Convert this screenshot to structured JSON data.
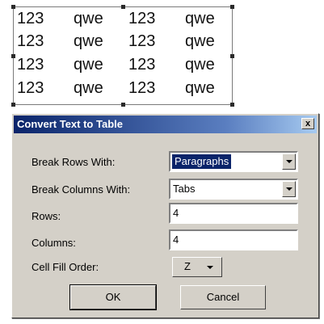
{
  "document_text": {
    "rows": [
      [
        "123",
        "qwe",
        "123",
        "qwe"
      ],
      [
        "123",
        "qwe",
        "123",
        "qwe"
      ],
      [
        "123",
        "qwe",
        "123",
        "qwe"
      ],
      [
        "123",
        "qwe",
        "123",
        "qwe"
      ]
    ]
  },
  "dialog": {
    "title": "Convert Text to Table",
    "close_glyph": "x",
    "break_rows": {
      "label": "Break Rows With:",
      "value": "Paragraphs"
    },
    "break_columns": {
      "label": "Break Columns With:",
      "value": "Tabs"
    },
    "rows": {
      "label": "Rows:",
      "value": "4"
    },
    "columns": {
      "label": "Columns:",
      "value": "4"
    },
    "cell_fill_order": {
      "label": "Cell Fill Order:",
      "icon": "z-order-icon",
      "glyph": "Z"
    },
    "ok_label": "OK",
    "cancel_label": "Cancel"
  },
  "colors": {
    "dialog_face": "#d4d0c8",
    "titlebar_start": "#0a246a",
    "titlebar_end": "#a6caf0",
    "selection": "#0a246a"
  }
}
